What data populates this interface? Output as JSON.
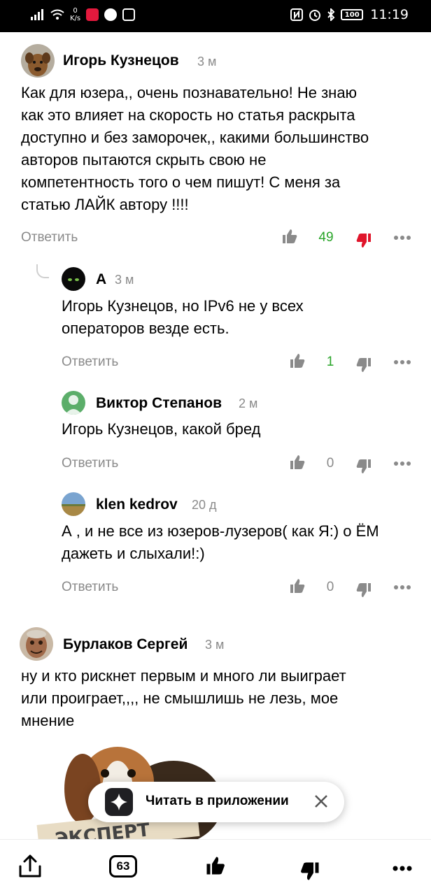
{
  "status_bar": {
    "net_speed_value": "0",
    "net_speed_unit": "K/s",
    "battery": "100",
    "time": "11:19"
  },
  "colors": {
    "like_green": "#2aa52a",
    "dislike_red": "#e0152b",
    "meta_gray": "#8a8a8a"
  },
  "comments": [
    {
      "author": "Игорь Кузнецов",
      "time": "3 м",
      "lines": [
        "Как для юзера,, очень познавательно! Не знаю",
        "как это влияет на скорость но статья раскрыта",
        "доступно и без заморочек,, какими большинство",
        "авторов пытаются скрыть свою не",
        "компетентность того о чем пишут! С меня за",
        "статью ЛАЙК автору !!!!"
      ],
      "reply_label": "Ответить",
      "likes": "49"
    },
    {
      "author": "А",
      "time": "3 м",
      "lines": [
        "Игорь Кузнецов, но IPv6 не у всех",
        "операторов везде есть."
      ],
      "reply_label": "Ответить",
      "likes": "1"
    },
    {
      "author": "Виктор Степанов",
      "time": "2 м",
      "lines": [
        "Игорь Кузнецов, какой бред"
      ],
      "reply_label": "Ответить",
      "likes": "0"
    },
    {
      "author": "klen kedrov",
      "time": "20 д",
      "lines": [
        "А , и не все из юзеров-лузеров( как Я:) о ЁМ",
        "дажеть и слыхали!:)"
      ],
      "reply_label": "Ответить",
      "likes": "0"
    },
    {
      "author": "Бурлаков Сергей",
      "time": "3 м",
      "lines": [
        "ну и кто рискнет первым и много ли выиграет",
        "или проиграет,,,, не смышлишь не лезь, мое",
        "мнение"
      ]
    }
  ],
  "image_sign_text": "ЭКСПЕРТ",
  "open_in_app": {
    "label": "Читать в приложении"
  },
  "bottom_bar": {
    "comment_count": "63"
  }
}
